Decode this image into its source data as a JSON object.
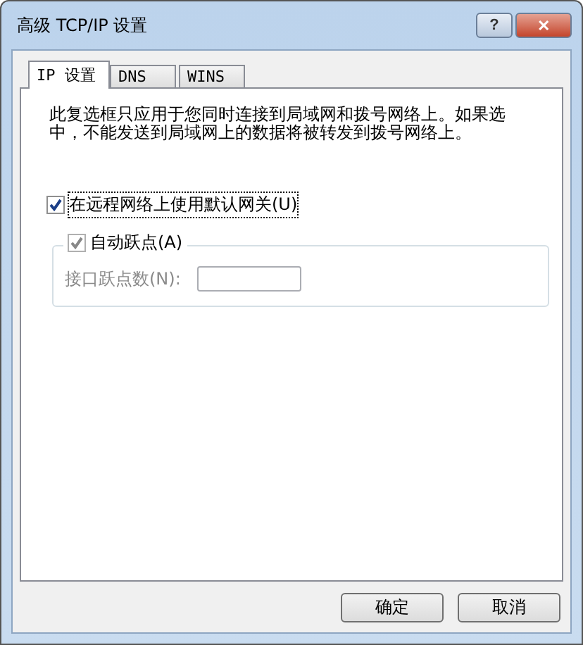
{
  "window": {
    "title": "高级 TCP/IP 设置",
    "help": "?",
    "close": "✕"
  },
  "tabs": [
    {
      "label": "IP 设置",
      "selected": true
    },
    {
      "label": "DNS",
      "selected": false
    },
    {
      "label": "WINS",
      "selected": false
    }
  ],
  "description": "此复选框只应用于您同时连接到局域网和拨号网络上。如果选中，不能发送到局域网上的数据将被转发到拨号网络上。",
  "gateway_checkbox": {
    "label": "在远程网络上使用默认网关(U)",
    "checked": true
  },
  "auto_metric": {
    "label": "自动跃点(A)",
    "checked": true,
    "disabled": true
  },
  "metric_field": {
    "label": "接口跃点数(N):",
    "disabled": true
  },
  "buttons": [
    "确定",
    "取消"
  ]
}
